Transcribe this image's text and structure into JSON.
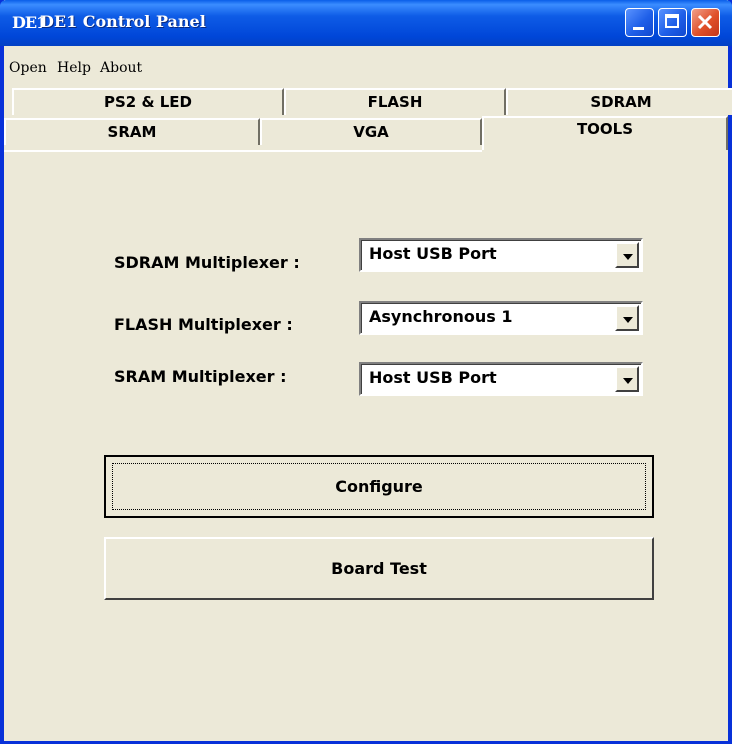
{
  "window": {
    "app_logo": "DE1",
    "title": "DE1 Control Panel"
  },
  "menu": {
    "items": [
      "Open",
      "Help",
      "About"
    ]
  },
  "tabs": {
    "row_back": [
      "PS2 & LED",
      "FLASH",
      "SDRAM"
    ],
    "row_front": [
      "SRAM",
      "VGA",
      "TOOLS"
    ],
    "active": "TOOLS"
  },
  "tools": {
    "sdram_label": "SDRAM Multiplexer :",
    "sdram_value": "Host USB Port",
    "flash_label": "FLASH Multiplexer :",
    "flash_value": "Asynchronous 1",
    "sram_label": "SRAM Multiplexer :",
    "sram_value": "Host USB Port",
    "configure_label": "Configure",
    "board_test_label": "Board Test"
  },
  "colors": {
    "titlebar": "#0046d8",
    "window_bg": "#ece9d8",
    "close_button": "#e0502a"
  }
}
